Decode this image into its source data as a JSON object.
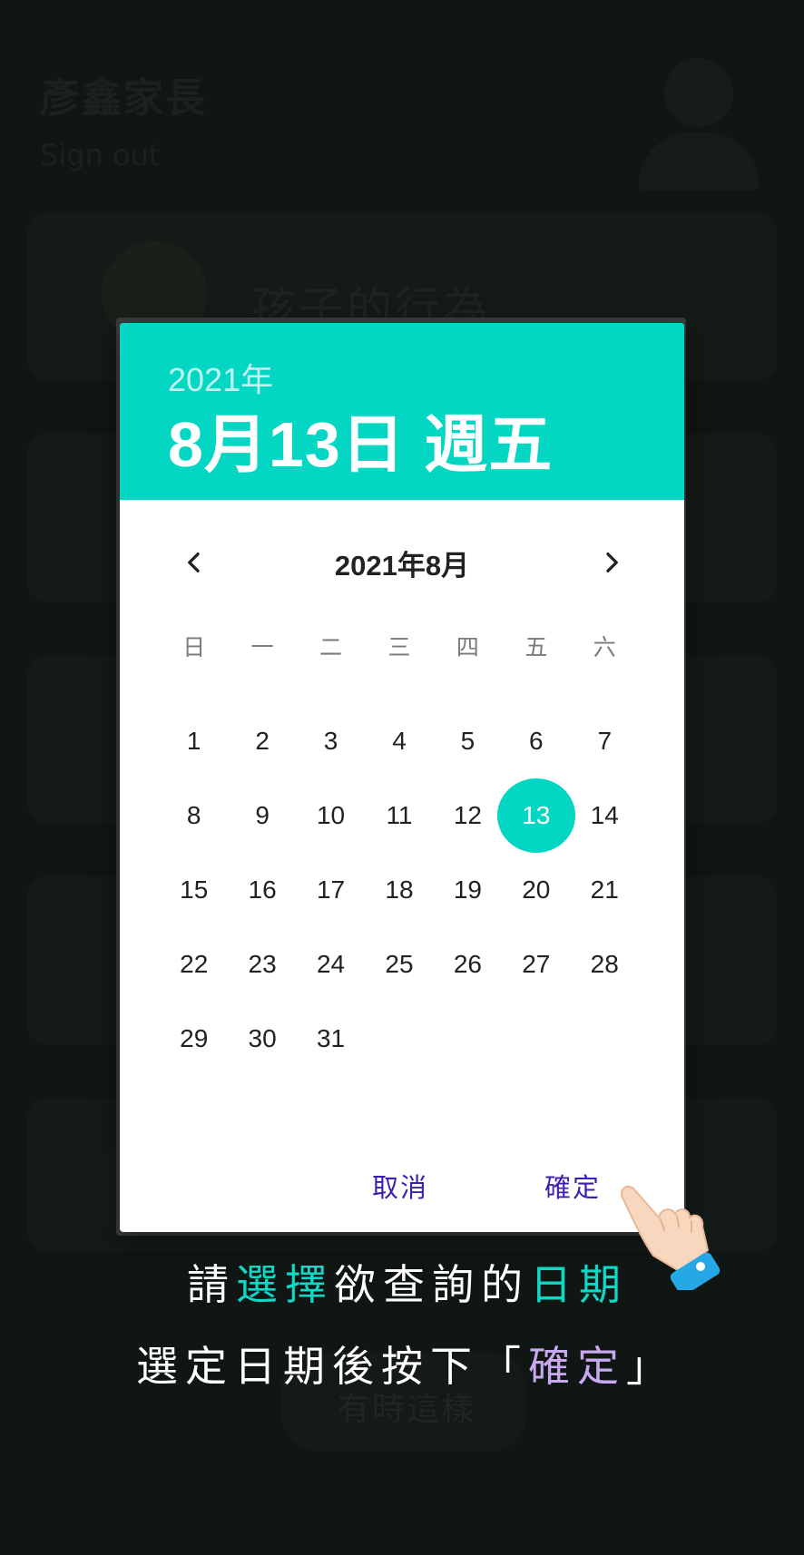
{
  "background": {
    "title": "彥鑫家長",
    "sign_out": "Sign out",
    "card_title": "孩子的行為",
    "pill_label": "有時這樣"
  },
  "dialog": {
    "header_year": "2021年",
    "header_date": "8月13日 週五",
    "month_label": "2021年8月",
    "weekdays": [
      "日",
      "一",
      "二",
      "三",
      "四",
      "五",
      "六"
    ],
    "days": [
      "1",
      "2",
      "3",
      "4",
      "5",
      "6",
      "7",
      "8",
      "9",
      "10",
      "11",
      "12",
      "13",
      "14",
      "15",
      "16",
      "17",
      "18",
      "19",
      "20",
      "21",
      "22",
      "23",
      "24",
      "25",
      "26",
      "27",
      "28",
      "29",
      "30",
      "31"
    ],
    "first_weekday_index": 0,
    "selected_day": "13",
    "cancel_label": "取消",
    "ok_label": "確定",
    "accent_color": "#03d6c3",
    "button_color": "#3d1fb0"
  },
  "instructions": {
    "line1": {
      "part1": "請",
      "part2": "選擇",
      "part3": "欲查詢的",
      "part4": "日期"
    },
    "line2": {
      "part1": "選定日期後按下「",
      "part2": "確定",
      "part3": "」"
    },
    "highlight_teal": "#11d8c6",
    "highlight_lilac": "#c8a8f0"
  },
  "icons": {
    "prev": "chevron-left-icon",
    "next": "chevron-right-icon",
    "pointer": "pointing-hand-icon",
    "avatar": "user-avatar-icon"
  }
}
